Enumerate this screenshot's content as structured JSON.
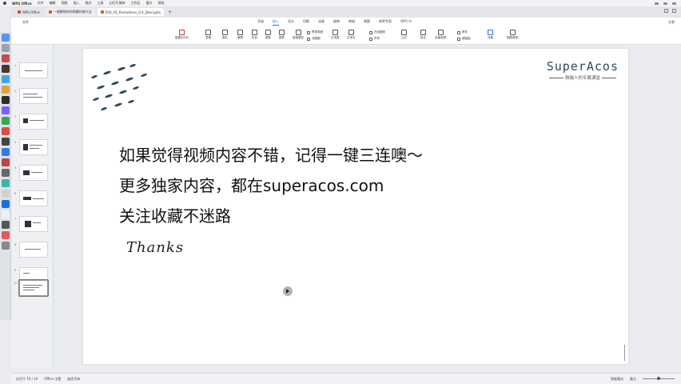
{
  "menubar": {
    "app_name": "WPS Office",
    "items": [
      "文件",
      "编辑",
      "视图",
      "插入",
      "格式",
      "工具",
      "幻灯片放映",
      "工作区",
      "窗口",
      "帮助"
    ]
  },
  "tabs": [
    {
      "label": "WPS Office"
    },
    {
      "label": "一键解锁你的隐藏技能大全"
    },
    {
      "label": "050_VS_Promotions_0.4_Deal.pptx"
    }
  ],
  "menu_tabs": {
    "file": "文件",
    "items": [
      "开始",
      "插入",
      "设计",
      "切换",
      "动画",
      "放映",
      "审阅",
      "视图",
      "效率专家"
    ],
    "active": "插入",
    "ai": "WPS AI",
    "share": "分享"
  },
  "ribbon": {
    "groups": [
      "新建幻灯片",
      "表格",
      "图片",
      "截屏",
      "形状",
      "图标",
      "图表",
      "智能图形",
      "文本框",
      "艺术字",
      "符号",
      "公式",
      "批注",
      "页眉页脚",
      "对象",
      "视频音频"
    ],
    "small": [
      "思维导图",
      "流程图",
      "在线图表",
      "附件",
      "超链接",
      "日期"
    ]
  },
  "slides": [
    {
      "num": "1"
    },
    {
      "num": "2"
    },
    {
      "num": "3"
    },
    {
      "num": "4"
    },
    {
      "num": "5"
    },
    {
      "num": "6"
    },
    {
      "num": "7"
    },
    {
      "num": "8"
    },
    {
      "num": "9"
    },
    {
      "num": "10"
    }
  ],
  "slide": {
    "brand": "SuperAcos",
    "brand_tagline": "跨端人的专属课堂",
    "line1": "如果觉得视频内容不错，记得一键三连噢～",
    "line2": "更多独家内容，都在superacos.com",
    "line3": "关注收藏不迷路",
    "thanks": "Thanks"
  },
  "statusbar": {
    "slide_info": "幻灯片 10 / 10",
    "theme": "Office 主题",
    "font_missing": "缺失字体",
    "notes": "备注",
    "zoom": "智能美化"
  },
  "colors": {
    "accent": "#2a6df4",
    "brand_text": "#2e4a5c",
    "deco_stroke": "#2f4a5e"
  }
}
